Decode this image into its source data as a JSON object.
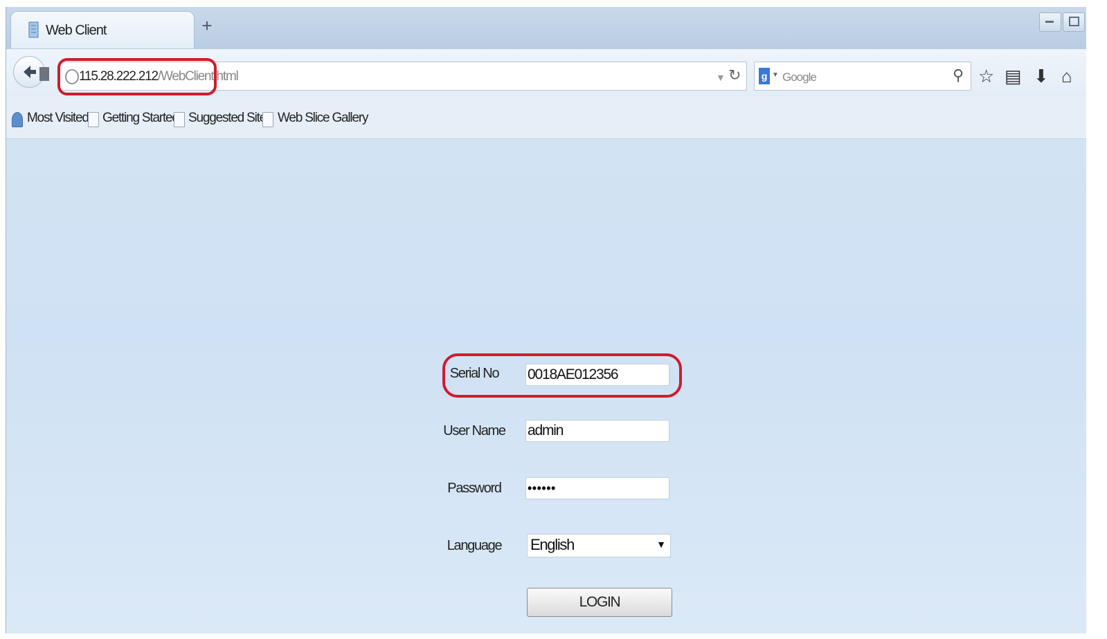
{
  "tab": {
    "title": "Web Client",
    "new_tab_symbol": "+"
  },
  "address_bar": {
    "host": "115.28.222.212",
    "path": "/WebClient.html"
  },
  "search_bar": {
    "engine_icon": "g",
    "placeholder": "Google"
  },
  "bookmarks": [
    {
      "label": "Most Visited"
    },
    {
      "label": "Getting Started"
    },
    {
      "label": "Suggested Sites"
    },
    {
      "label": "Web Slice Gallery"
    }
  ],
  "login_form": {
    "serial_label": "Serial No",
    "serial_value": "0018AE012356",
    "username_label": "User Name",
    "username_value": "admin",
    "password_label": "Password",
    "password_masked": "••••••",
    "language_label": "Language",
    "language_value": "English",
    "login_label": "LOGIN"
  },
  "icons": {
    "back": "back-arrow-icon",
    "reload": "reload-icon",
    "search": "magnifier-icon",
    "bookmark_star": "star-icon",
    "bookmarks_list": "clipboard-icon",
    "downloads": "download-arrow-icon",
    "home": "home-icon"
  },
  "annotation_color": "#cf1c2c"
}
